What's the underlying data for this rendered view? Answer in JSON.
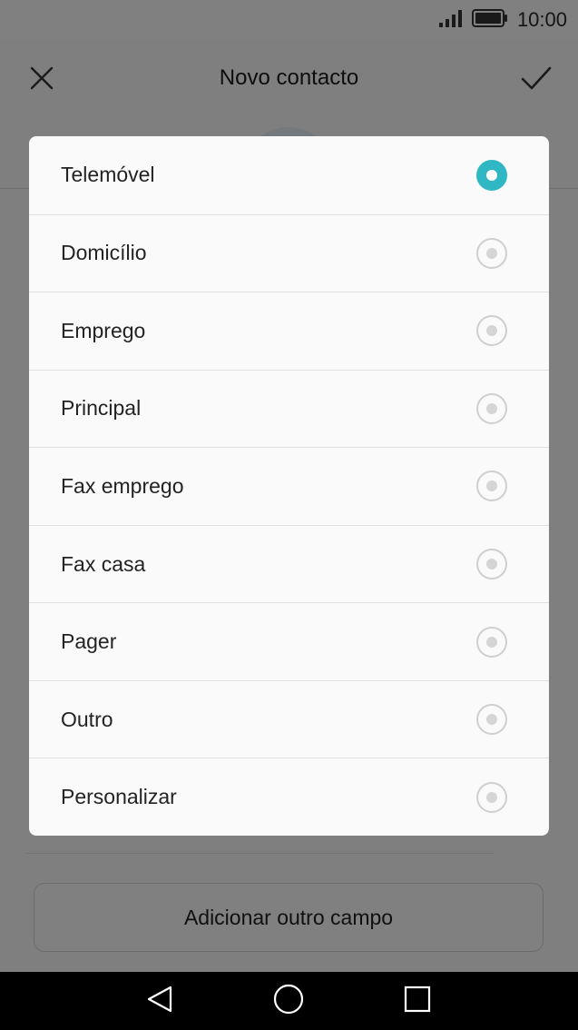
{
  "status_bar": {
    "time": "10:00",
    "signal_icon": "signal-icon",
    "battery_icon": "battery-icon"
  },
  "header": {
    "title": "Novo contacto",
    "close_icon": "close-icon",
    "confirm_icon": "checkmark-icon"
  },
  "page": {
    "add_field_label": "Adicionar outro campo"
  },
  "dialog": {
    "options": [
      {
        "label": "Telemóvel",
        "selected": true
      },
      {
        "label": "Domicílio",
        "selected": false
      },
      {
        "label": "Emprego",
        "selected": false
      },
      {
        "label": "Principal",
        "selected": false
      },
      {
        "label": "Fax emprego",
        "selected": false
      },
      {
        "label": "Fax casa",
        "selected": false
      },
      {
        "label": "Pager",
        "selected": false
      },
      {
        "label": "Outro",
        "selected": false
      },
      {
        "label": "Personalizar",
        "selected": false
      }
    ]
  },
  "colors": {
    "accent": "#2fb7c3",
    "scrim": "#000000",
    "dialog_background": "#fafafa"
  },
  "nav_bar": {
    "back_icon": "back-triangle-icon",
    "home_icon": "home-circle-icon",
    "recents_icon": "recents-square-icon"
  }
}
